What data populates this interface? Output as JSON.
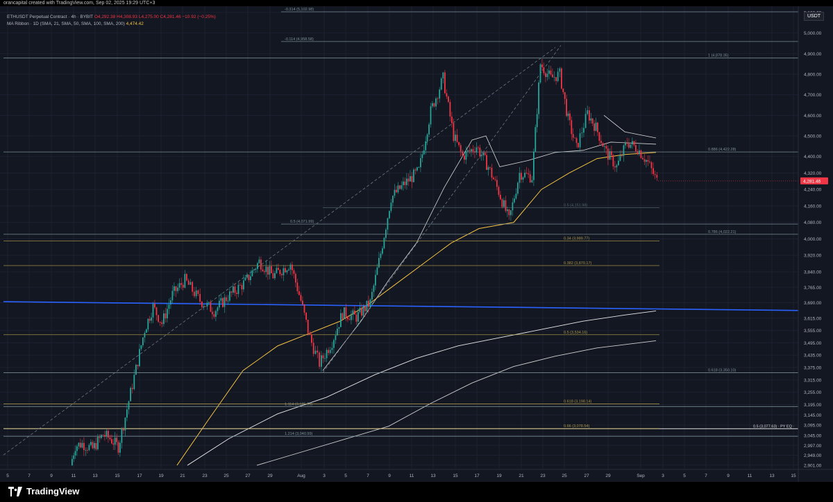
{
  "header": {
    "created_text": "orancapital created with TradingView.com, Sep 02, 2025 19:29 UTC+3",
    "symbol_line": "ETHUSDT Perpetual Contract · 4h · BYBIT",
    "ohlc": {
      "o": "O4,292.38",
      "h": "H4,308.93",
      "l": "L4,275.00",
      "c": "C4,281.46",
      "chg": "−10.92 (−0.25%)"
    },
    "ma_label": "MA Ribbon · 1D (SMA, 21, SMA, 50, SMA, 100, SMA, 200)",
    "ma_value": "4,474.42",
    "currency": "USDT",
    "brand": "TradingView"
  },
  "colors": {
    "bg": "#131722",
    "up": "#26a69a",
    "down": "#f23645",
    "ma21": "#e8e8e8",
    "ma50": "#f5c343",
    "blue": "#2962ff",
    "level": "#8fa3a8",
    "gold": "#b8a24a",
    "current": "#f23645"
  },
  "chart_data": {
    "type": "candlestick",
    "ylim": [
      2880,
      5130
    ],
    "y_ticks": [
      "5,100.00",
      "5,000.00",
      "4,900.00",
      "4,800.00",
      "4,700.00",
      "4,600.00",
      "4,500.00",
      "4,400.00",
      "4,320.00",
      "4,240.00",
      "4,160.00",
      "4,080.00",
      "4,000.00",
      "3,920.00",
      "3,840.00",
      "3,765.00",
      "3,690.00",
      "3,615.00",
      "3,555.00",
      "3,495.00",
      "3,435.00",
      "3,375.00",
      "3,315.00",
      "3,255.00",
      "3,195.00",
      "3,145.00",
      "3,095.00",
      "3,045.00",
      "2,997.00",
      "2,949.00",
      "2,901.00"
    ],
    "y_tick_values": [
      5100,
      5000,
      4900,
      4800,
      4700,
      4600,
      4500,
      4400,
      4320,
      4240,
      4160,
      4080,
      4000,
      3920,
      3840,
      3765,
      3690,
      3615,
      3555,
      3495,
      3435,
      3375,
      3315,
      3255,
      3195,
      3145,
      3095,
      3045,
      2997,
      2949,
      2901
    ],
    "x_ticks": [
      {
        "l": "5",
        "x": 11
      },
      {
        "l": "7",
        "x": 42
      },
      {
        "l": "9",
        "x": 74
      },
      {
        "l": "11",
        "x": 106
      },
      {
        "l": "13",
        "x": 137
      },
      {
        "l": "15",
        "x": 169
      },
      {
        "l": "17",
        "x": 201
      },
      {
        "l": "19",
        "x": 232
      },
      {
        "l": "21",
        "x": 263
      },
      {
        "l": "23",
        "x": 295
      },
      {
        "l": "25",
        "x": 326
      },
      {
        "l": "27",
        "x": 357
      },
      {
        "l": "29",
        "x": 389
      },
      {
        "l": "Aug",
        "x": 434
      },
      {
        "l": "3",
        "x": 467
      },
      {
        "l": "5",
        "x": 498
      },
      {
        "l": "7",
        "x": 530
      },
      {
        "l": "9",
        "x": 561
      },
      {
        "l": "11",
        "x": 593
      },
      {
        "l": "13",
        "x": 624
      },
      {
        "l": "15",
        "x": 656
      },
      {
        "l": "17",
        "x": 687
      },
      {
        "l": "19",
        "x": 719
      },
      {
        "l": "21",
        "x": 751
      },
      {
        "l": "23",
        "x": 782
      },
      {
        "l": "25",
        "x": 813
      },
      {
        "l": "27",
        "x": 845
      },
      {
        "l": "29",
        "x": 876
      },
      {
        "l": "Sep",
        "x": 923
      },
      {
        "l": "3",
        "x": 955
      },
      {
        "l": "5",
        "x": 986
      },
      {
        "l": "7",
        "x": 1017
      },
      {
        "l": "9",
        "x": 1049
      },
      {
        "l": "11",
        "x": 1080
      },
      {
        "l": "13",
        "x": 1112
      },
      {
        "l": "15",
        "x": 1143
      }
    ],
    "current_price": {
      "value": 4281.46,
      "label": "4,281.46"
    },
    "levels": [
      {
        "label": "-0.314 (5,102.98)",
        "value": 5102.98,
        "x1": 405,
        "x2": 1150,
        "lx": 410,
        "color": "level"
      },
      {
        "label": "-0.114 (4,958.58)",
        "value": 4958.58,
        "x1": 405,
        "x2": 1150,
        "lx": 410,
        "color": "level"
      },
      {
        "label": "1 (4,878.35)",
        "value": 4878.35,
        "x1": 5,
        "x2": 1150,
        "lx": 1020,
        "color": "level"
      },
      {
        "label": "0.886 (4,422.28)",
        "value": 4422.28,
        "x1": 5,
        "x2": 1150,
        "lx": 1020,
        "color": "level"
      },
      {
        "label": "0.786 (4,022.21)",
        "value": 4022.21,
        "x1": 5,
        "x2": 1150,
        "lx": 1020,
        "color": "level"
      },
      {
        "label": "0.5 (4,071.99)",
        "value": 4071.99,
        "x1": 405,
        "x2": 1150,
        "lx": 418,
        "color": "level"
      },
      {
        "label": "0.5 (4,151.98)",
        "value": 4151.98,
        "x1": 465,
        "x2": 950,
        "lx": 812,
        "color": "dim"
      },
      {
        "label": "0.34 (3,989.77)",
        "value": 3989.77,
        "x1": 5,
        "x2": 950,
        "lx": 812,
        "color": "gold"
      },
      {
        "label": "0.382 (3,870.17)",
        "value": 3870.17,
        "x1": 5,
        "x2": 950,
        "lx": 812,
        "color": "gold"
      },
      {
        "label": "0.5 (3,534.16)",
        "value": 3534.16,
        "x1": 5,
        "x2": 950,
        "lx": 812,
        "color": "gold"
      },
      {
        "label": "0.618 (3,350.10)",
        "value": 3350.1,
        "x1": 5,
        "x2": 1150,
        "lx": 1020,
        "color": "level"
      },
      {
        "label": "1.114 (3,185.39)",
        "value": 3185.39,
        "x1": 5,
        "x2": 1150,
        "lx": 410,
        "color": "level"
      },
      {
        "label": "0.618 (3,198.14)",
        "value": 3198.14,
        "x1": 5,
        "x2": 950,
        "lx": 812,
        "color": "gold"
      },
      {
        "label": "0.5 (3,077.63) · PY EQ ·",
        "value": 3077.63,
        "x1": 5,
        "x2": 1150,
        "lx": 1085,
        "color": "white"
      },
      {
        "label": "0.66 (3,078.54)",
        "value": 3078.54,
        "x1": 5,
        "x2": 950,
        "lx": 812,
        "color": "gold"
      },
      {
        "label": "1.214 (3,040.99)",
        "value": 3040.99,
        "x1": 5,
        "x2": 1150,
        "lx": 410,
        "color": "level"
      }
    ],
    "trendline": {
      "x1": 5,
      "y1": 3695,
      "x2": 1150,
      "y2": 3652,
      "color": "blue"
    },
    "candles_anchor": [
      [
        103,
        2900
      ],
      [
        110,
        2995
      ],
      [
        120,
        3005
      ],
      [
        135,
        2980
      ],
      [
        150,
        3050
      ],
      [
        160,
        3030
      ],
      [
        172,
        2990
      ],
      [
        182,
        3135
      ],
      [
        195,
        3330
      ],
      [
        210,
        3560
      ],
      [
        222,
        3670
      ],
      [
        235,
        3590
      ],
      [
        250,
        3730
      ],
      [
        268,
        3800
      ],
      [
        290,
        3700
      ],
      [
        310,
        3650
      ],
      [
        330,
        3720
      ],
      [
        355,
        3790
      ],
      [
        375,
        3890
      ],
      [
        395,
        3820
      ],
      [
        420,
        3880
      ],
      [
        435,
        3700
      ],
      [
        448,
        3520
      ],
      [
        462,
        3395
      ],
      [
        480,
        3500
      ],
      [
        495,
        3640
      ],
      [
        515,
        3620
      ],
      [
        535,
        3690
      ],
      [
        550,
        3930
      ],
      [
        565,
        4200
      ],
      [
        585,
        4270
      ],
      [
        605,
        4330
      ],
      [
        622,
        4620
      ],
      [
        640,
        4780
      ],
      [
        655,
        4500
      ],
      [
        668,
        4400
      ],
      [
        688,
        4450
      ],
      [
        705,
        4350
      ],
      [
        720,
        4230
      ],
      [
        735,
        4090
      ],
      [
        750,
        4320
      ],
      [
        768,
        4300
      ],
      [
        780,
        4850
      ],
      [
        795,
        4780
      ],
      [
        808,
        4800
      ],
      [
        820,
        4580
      ],
      [
        832,
        4440
      ],
      [
        848,
        4610
      ],
      [
        860,
        4540
      ],
      [
        875,
        4420
      ],
      [
        890,
        4350
      ],
      [
        905,
        4470
      ],
      [
        920,
        4440
      ],
      [
        935,
        4370
      ],
      [
        948,
        4281
      ]
    ],
    "ma_ribbon": {
      "ma21_upper": [
        [
          870,
          4600
        ],
        [
          900,
          4520
        ],
        [
          945,
          4490
        ]
      ],
      "ma21": [
        [
          465,
          3360
        ],
        [
          520,
          3600
        ],
        [
          560,
          3800
        ],
        [
          600,
          3980
        ],
        [
          640,
          4250
        ],
        [
          680,
          4480
        ],
        [
          700,
          4500
        ],
        [
          720,
          4350
        ],
        [
          760,
          4380
        ],
        [
          800,
          4420
        ],
        [
          840,
          4430
        ],
        [
          880,
          4470
        ],
        [
          945,
          4460
        ]
      ],
      "ma50": [
        [
          255,
          2900
        ],
        [
          300,
          3120
        ],
        [
          350,
          3360
        ],
        [
          400,
          3480
        ],
        [
          445,
          3540
        ],
        [
          490,
          3600
        ],
        [
          530,
          3680
        ],
        [
          570,
          3780
        ],
        [
          610,
          3880
        ],
        [
          650,
          3980
        ],
        [
          690,
          4050
        ],
        [
          740,
          4080
        ],
        [
          780,
          4240
        ],
        [
          820,
          4320
        ],
        [
          860,
          4390
        ],
        [
          900,
          4410
        ],
        [
          945,
          4420
        ]
      ],
      "ma100": [
        [
          270,
          2900
        ],
        [
          330,
          3030
        ],
        [
          400,
          3150
        ],
        [
          470,
          3230
        ],
        [
          540,
          3340
        ],
        [
          600,
          3420
        ],
        [
          660,
          3480
        ],
        [
          720,
          3520
        ],
        [
          780,
          3560
        ],
        [
          840,
          3600
        ],
        [
          900,
          3630
        ],
        [
          945,
          3650
        ]
      ],
      "ma200": [
        [
          370,
          2900
        ],
        [
          430,
          2960
        ],
        [
          500,
          3030
        ],
        [
          560,
          3090
        ],
        [
          620,
          3200
        ],
        [
          680,
          3300
        ],
        [
          740,
          3380
        ],
        [
          800,
          3430
        ],
        [
          860,
          3470
        ],
        [
          945,
          3505
        ]
      ]
    }
  }
}
